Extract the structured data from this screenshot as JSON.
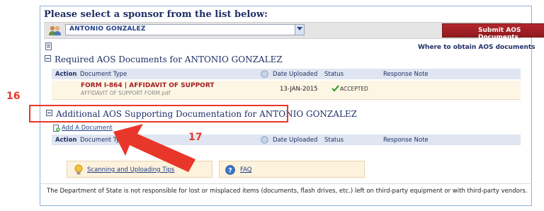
{
  "header": {
    "title": "Please select a sponsor from the list below:"
  },
  "sponsor_select": {
    "selected": "ANTONIO GONZALEZ"
  },
  "submit_button": {
    "label": "Submit AOS Documents"
  },
  "where_link": "Where to obtain AOS documents",
  "required_section": {
    "title": "Required AOS Documents for ANTONIO GONZALEZ",
    "columns": [
      "Action",
      "Document Type",
      "Date Uploaded",
      "Status",
      "Response Note"
    ],
    "rows": [
      {
        "doc_title": "FORM I-864 | AFFIDAVIT OF SUPPORT",
        "doc_file": "AFFIDAVIT OF SUPPORT FORM.pdf",
        "date": "13-JAN-2015",
        "status": "ACCEPTED"
      }
    ]
  },
  "additional_section": {
    "title": "Additional AOS Supporting Documentation for ANTONIO GONZALEZ",
    "add_link": "Add A Document",
    "columns": [
      "Action",
      "Document Type",
      "Date Uploaded",
      "Status",
      "Response Note"
    ]
  },
  "tips": {
    "scanning": "Scanning and Uploading Tips",
    "faq": "FAQ"
  },
  "footer": "The Department of State is not responsible for lost or misplaced items (documents, flash drives, etc.) left on third-party equipment or with third-party vendors.",
  "annotations": {
    "callout_16": "16",
    "callout_17": "17"
  },
  "colors": {
    "accent_red": "#e8372a",
    "button_red": "#a21c23",
    "navy": "#1f2f66"
  }
}
